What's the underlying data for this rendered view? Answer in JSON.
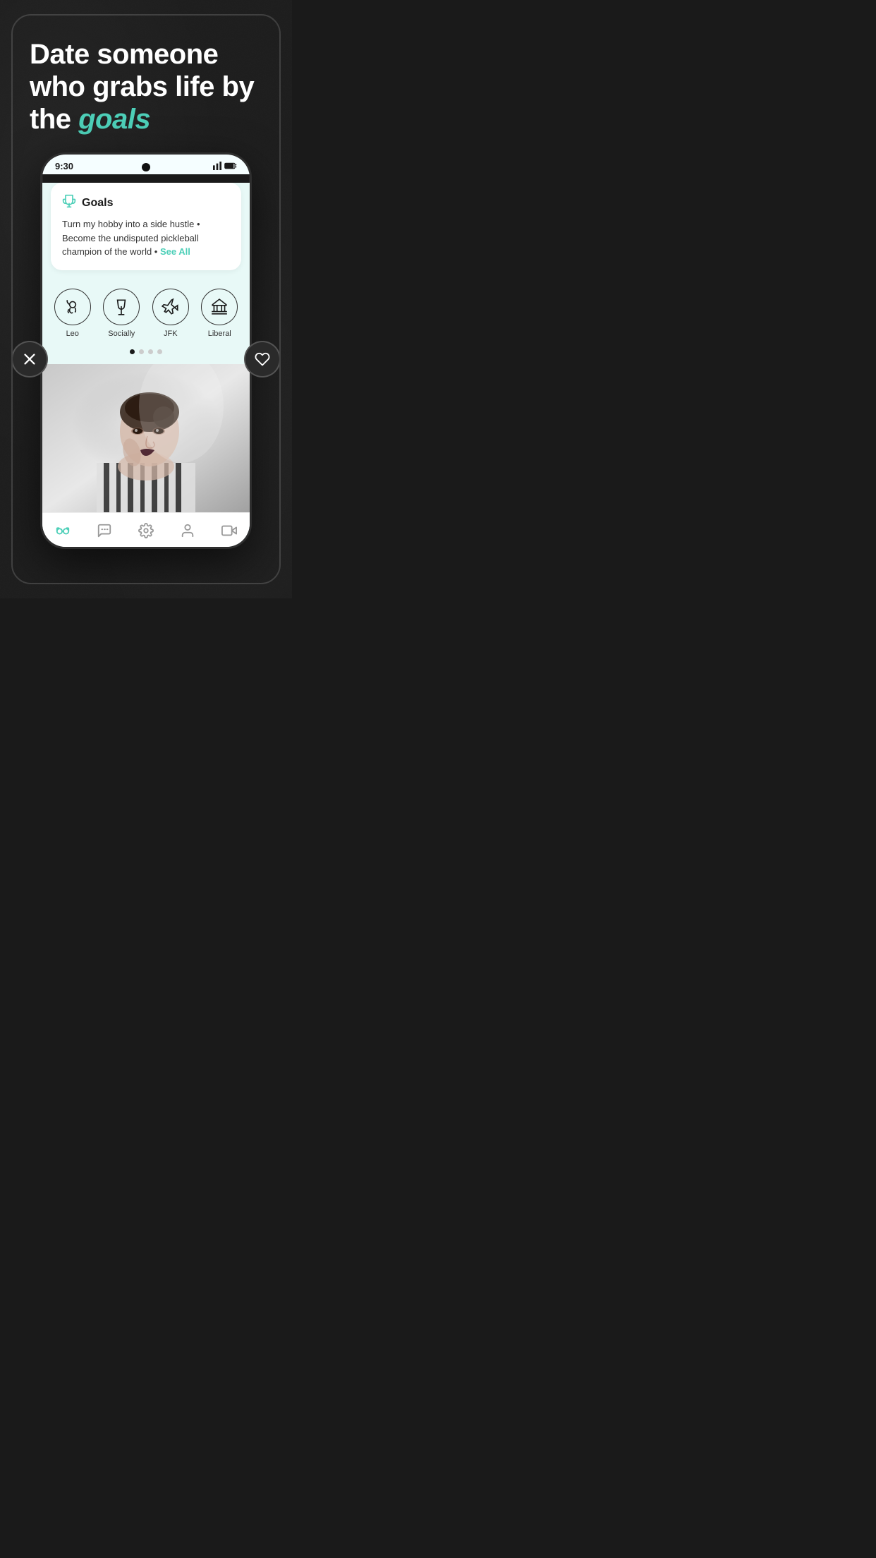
{
  "headline": {
    "line1": "Date someone",
    "line2": "who grabs life by",
    "line3_normal": "the ",
    "line3_accent": "goals"
  },
  "phone": {
    "status_time": "9:30",
    "goals_card": {
      "title": "Goals",
      "text": "Turn my hobby into a side hustle • Become the undisputed pickleball champion of the world •",
      "see_all": "See All"
    },
    "tags": [
      {
        "label": "Leo",
        "icon": "leo"
      },
      {
        "label": "Socially",
        "icon": "socially"
      },
      {
        "label": "JFK",
        "icon": "jfk"
      },
      {
        "label": "Liberal",
        "icon": "liberal"
      }
    ],
    "dots": [
      {
        "active": true
      },
      {
        "active": false
      },
      {
        "active": false
      },
      {
        "active": false
      }
    ]
  },
  "buttons": {
    "dislike_label": "×",
    "like_label": "♡"
  },
  "nav": {
    "items": [
      {
        "label": "discover",
        "active": true
      },
      {
        "label": "messages",
        "active": false
      },
      {
        "label": "settings",
        "active": false
      },
      {
        "label": "profile",
        "active": false
      },
      {
        "label": "video",
        "active": false
      }
    ]
  }
}
